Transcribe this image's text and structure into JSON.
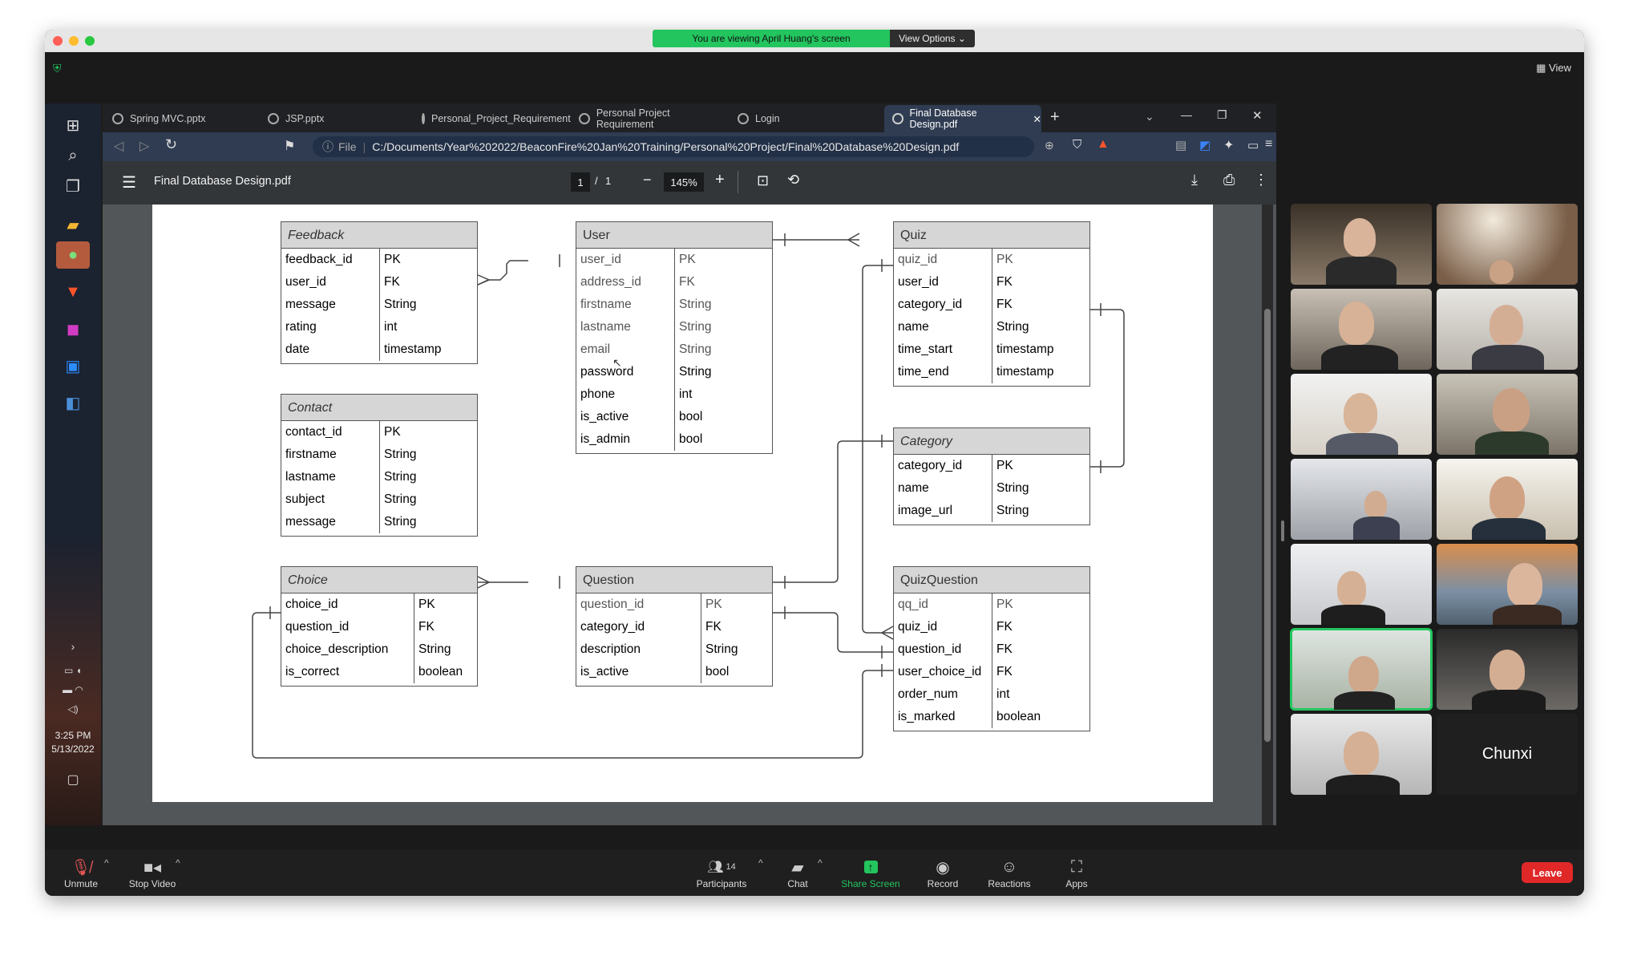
{
  "banner": {
    "text": "You are viewing April Huang's screen",
    "options_label": "View Options ⌄"
  },
  "zoom_top": {
    "view_label": "View"
  },
  "taskbar": {
    "time": "3:25 PM",
    "date": "5/13/2022"
  },
  "browser": {
    "tabs": [
      {
        "label": "Spring MVC.pptx"
      },
      {
        "label": "JSP.pptx"
      },
      {
        "label": "Personal_Project_Requirement"
      },
      {
        "label": "Personal Project Requirement"
      },
      {
        "label": "Login"
      },
      {
        "label": "Final Database Design.pdf"
      }
    ],
    "url_prefix": "File",
    "url": "C:/Documents/Year%202022/BeaconFire%20Jan%20Training/Personal%20Project/Final%20Database%20Design.pdf"
  },
  "pdf": {
    "title": "Final Database Design.pdf",
    "page_current": "1",
    "page_total": "1",
    "zoom": "145%"
  },
  "er": {
    "feedback": {
      "title": "Feedback",
      "rows": [
        [
          "feedback_id",
          "PK"
        ],
        [
          "user_id",
          "FK"
        ],
        [
          "message",
          "String"
        ],
        [
          "rating",
          "int"
        ],
        [
          "date",
          "timestamp"
        ]
      ]
    },
    "contact": {
      "title": "Contact",
      "rows": [
        [
          "contact_id",
          "PK"
        ],
        [
          "firstname",
          "String"
        ],
        [
          "lastname",
          "String"
        ],
        [
          "subject",
          "String"
        ],
        [
          "message",
          "String"
        ]
      ]
    },
    "choice": {
      "title": "Choice",
      "rows": [
        [
          "choice_id",
          "PK"
        ],
        [
          "question_id",
          "FK"
        ],
        [
          "choice_description",
          "String"
        ],
        [
          "is_correct",
          "boolean"
        ]
      ]
    },
    "user": {
      "title": "User",
      "rows": [
        [
          "user_id",
          "PK"
        ],
        [
          "address_id",
          "FK"
        ],
        [
          "firstname",
          "String"
        ],
        [
          "lastname",
          "String"
        ],
        [
          "email",
          "String"
        ],
        [
          "password",
          "String"
        ],
        [
          "phone",
          "int"
        ],
        [
          "is_active",
          "bool"
        ],
        [
          "is_admin",
          "bool"
        ]
      ]
    },
    "question": {
      "title": "Question",
      "rows": [
        [
          "question_id",
          "PK"
        ],
        [
          "category_id",
          "FK"
        ],
        [
          "description",
          "String"
        ],
        [
          "is_active",
          "bool"
        ]
      ]
    },
    "quiz": {
      "title": "Quiz",
      "rows": [
        [
          "quiz_id",
          "PK"
        ],
        [
          "user_id",
          "FK"
        ],
        [
          "category_id",
          "FK"
        ],
        [
          "name",
          "String"
        ],
        [
          "time_start",
          "timestamp"
        ],
        [
          "time_end",
          "timestamp"
        ]
      ]
    },
    "category": {
      "title": "Category",
      "rows": [
        [
          "category_id",
          "PK"
        ],
        [
          "name",
          "String"
        ],
        [
          "image_url",
          "String"
        ]
      ]
    },
    "quizquestion": {
      "title": "QuizQuestion",
      "rows": [
        [
          "qq_id",
          "PK"
        ],
        [
          "quiz_id",
          "FK"
        ],
        [
          "question_id",
          "FK"
        ],
        [
          "user_choice_id",
          "FK"
        ],
        [
          "order_num",
          "int"
        ],
        [
          "is_marked",
          "boolean"
        ]
      ]
    }
  },
  "gallery": {
    "name_tile": "Chunxi"
  },
  "controls": {
    "unmute": "Unmute",
    "stop_video": "Stop Video",
    "participants": "Participants",
    "participants_count": "14",
    "chat": "Chat",
    "share_screen": "Share Screen",
    "record": "Record",
    "reactions": "Reactions",
    "apps": "Apps",
    "leave": "Leave"
  },
  "colors": {
    "accent_green": "#22c55e",
    "leave_red": "#e02828",
    "tab_active": "#2f3c52"
  }
}
